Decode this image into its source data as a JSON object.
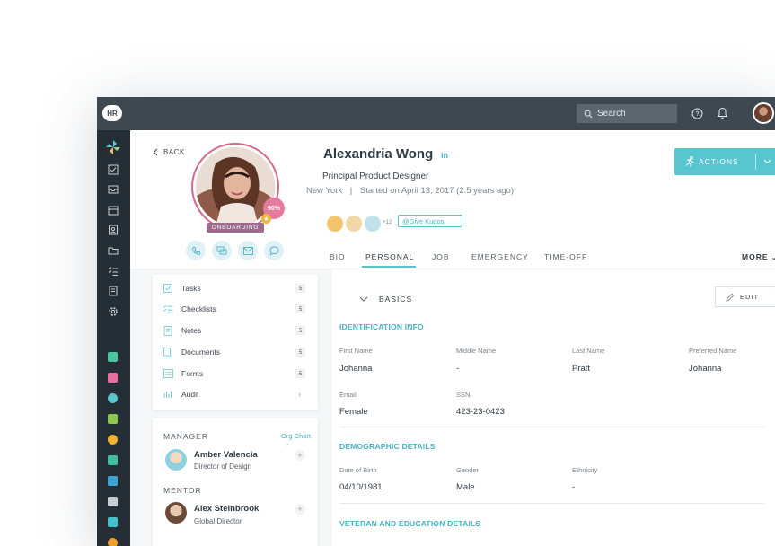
{
  "topbar": {
    "logo_text": "HR",
    "search_placeholder": "Search"
  },
  "profile": {
    "back_label": "BACK",
    "completion": "90%",
    "status_badge": "ONBOARDING",
    "name": "Alexandria Wong",
    "linkedin": "in",
    "title": "Principal Product Designer",
    "location": "New York",
    "separator": "|",
    "started": "Started on April 13, 2017 (2.5 years ago)",
    "kudos_more": "+12",
    "give_kudos": "Give Kudos"
  },
  "actions": {
    "label": "ACTIONS"
  },
  "tabs": [
    "BIO",
    "PERSONAL",
    "JOB",
    "EMERGENCY",
    "TIME-OFF"
  ],
  "active_tab": "PERSONAL",
  "more_label": "MORE",
  "menu": [
    {
      "label": "Tasks",
      "count": "5",
      "icon": "tasks-icon"
    },
    {
      "label": "Checklists",
      "count": "5",
      "icon": "checklist-icon"
    },
    {
      "label": "Notes",
      "count": "5",
      "icon": "notes-icon"
    },
    {
      "label": "Documents",
      "count": "5",
      "icon": "documents-icon"
    },
    {
      "label": "Forms",
      "count": "5",
      "icon": "forms-icon"
    },
    {
      "label": "Audit",
      "count": "",
      "icon": "audit-icon"
    }
  ],
  "manager": {
    "section_label": "MANAGER",
    "org_chart": "Org Chart",
    "name": "Amber Valencia",
    "role": "Director of Design"
  },
  "mentor": {
    "section_label": "MENTOR",
    "name": "Alex Steinbrook",
    "role": "Global Director"
  },
  "basics": {
    "section_label": "BASICS",
    "edit_label": "EDIT",
    "identification": {
      "title": "IDENTIFICATION INFO",
      "first_name_label": "First Name",
      "first_name": "Johanna",
      "middle_name_label": "Middle Name",
      "middle_name": "-",
      "last_name_label": "Last Name",
      "last_name": "Pratt",
      "preferred_name_label": "Preferred Name",
      "preferred_name": "Johanna",
      "email_label": "Email",
      "email": "Female",
      "ssn_label": "SSN",
      "ssn": "423-23-0423"
    },
    "demographic": {
      "title": "DEMOGRAPHIC DETAILS",
      "dob_label": "Date of Birth",
      "dob": "04/10/1981",
      "gender_label": "Gender",
      "gender": "Male",
      "ethnicity_label": "Ethnicity",
      "ethnicity": "-"
    },
    "veteran": {
      "title": "VETERAN AND EDUCATION DETAILS"
    }
  },
  "colors": {
    "accent": "#58c6cf",
    "topbar": "#3d4850",
    "sidebar": "#252e35",
    "onboarding": "#9c6b8c",
    "completion": "#e57c9d"
  }
}
